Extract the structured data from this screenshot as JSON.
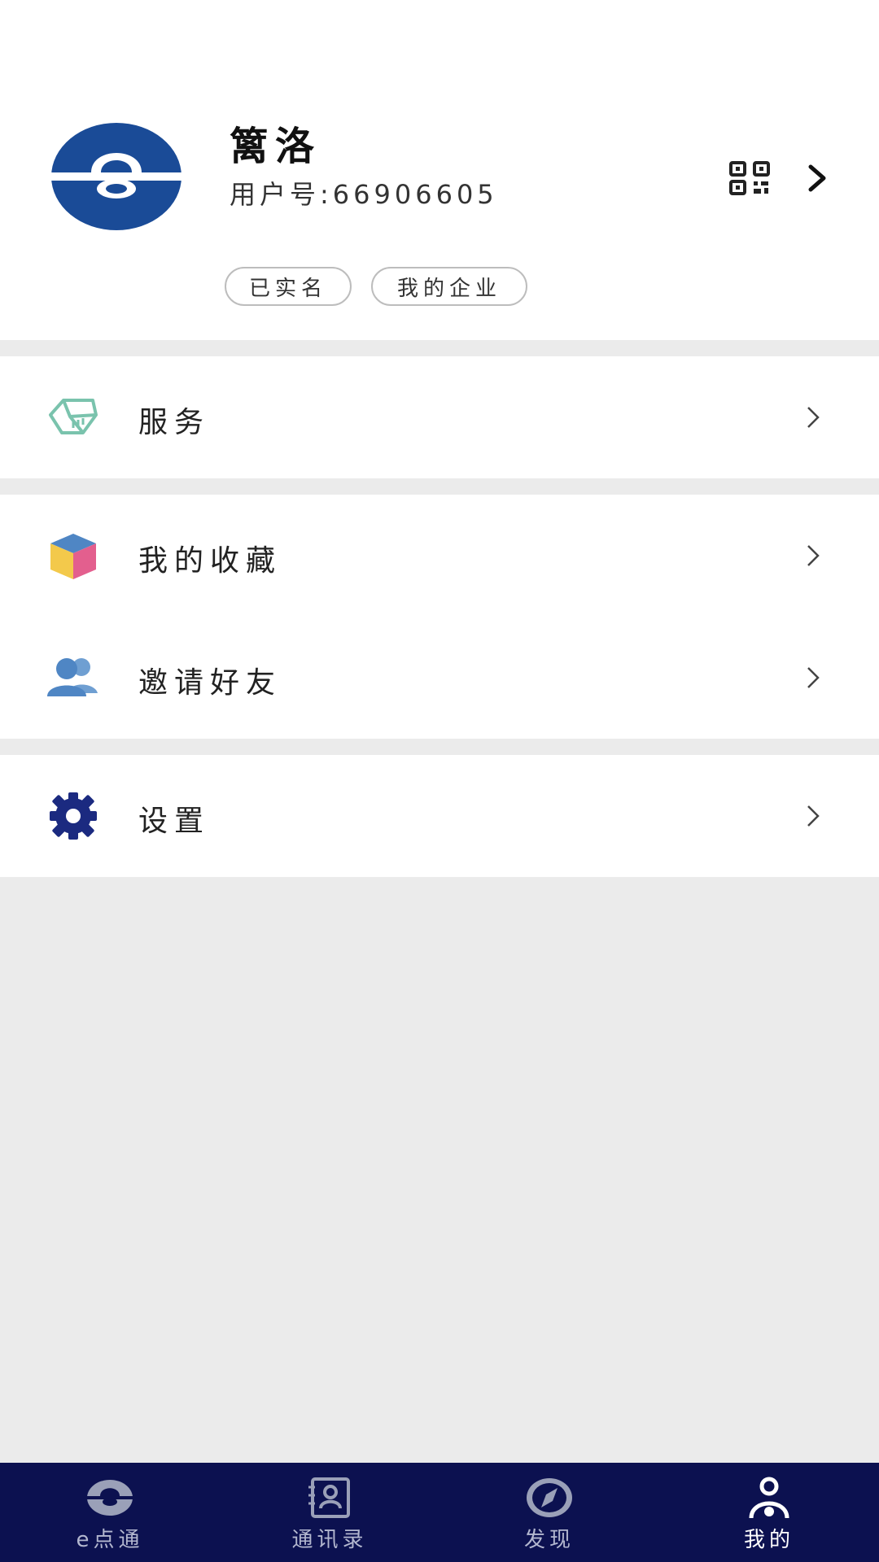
{
  "profile": {
    "name": "篱洛",
    "user_id": "用户号:66906605",
    "tags": [
      "已实名",
      "我的企业"
    ]
  },
  "menu": {
    "service": "服务",
    "favorites": "我的收藏",
    "invite": "邀请好友",
    "settings": "设置"
  },
  "tabs": [
    {
      "label": "e点通",
      "icon": "logo-icon"
    },
    {
      "label": "通讯录",
      "icon": "contacts-icon"
    },
    {
      "label": "发现",
      "icon": "compass-icon"
    },
    {
      "label": "我的",
      "icon": "person-icon"
    }
  ],
  "active_tab": 3,
  "colors": {
    "brand_blue": "#1a4b97",
    "tab_bg": "#0c1150",
    "service_icon": "#7ac3ad",
    "invite_icon": "#4f86c4",
    "settings_icon": "#1b2a80"
  }
}
